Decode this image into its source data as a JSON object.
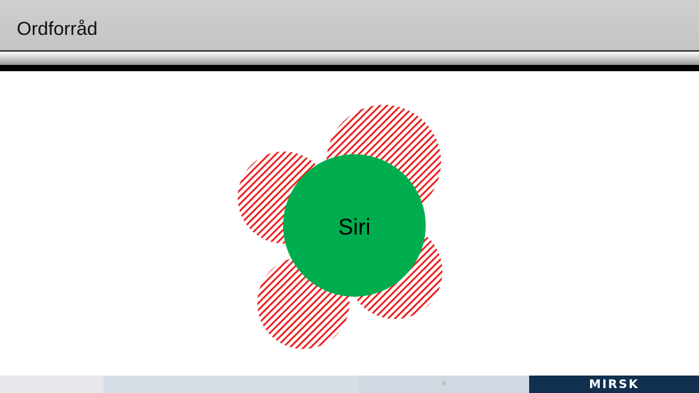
{
  "slide": {
    "title": "Ordforråd",
    "center_label": "Siri",
    "page_number": "8",
    "logo_text": "MIRSK"
  },
  "colors": {
    "center_fill": "#00AD4E",
    "petal_stripe": "#E8211F",
    "title_bar": "#C8C8C8",
    "footer_logo_bg": "#11304F"
  },
  "diagram": {
    "center_node": {
      "label_key": "slide.center_label"
    },
    "petal_count": 5,
    "petal_pattern": "red-diagonal-hatch"
  }
}
